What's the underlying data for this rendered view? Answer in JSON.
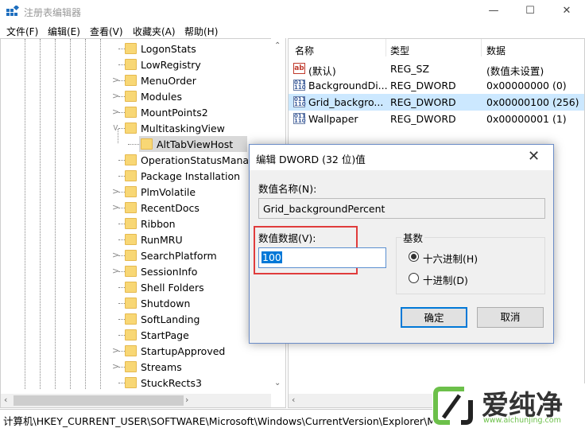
{
  "window": {
    "title": "注册表编辑器",
    "controls": {
      "minimize": "—",
      "maximize": "☐",
      "close": "✕"
    }
  },
  "menu": [
    "文件(F)",
    "编辑(E)",
    "查看(V)",
    "收藏夹(A)",
    "帮助(H)"
  ],
  "tree": {
    "items": [
      {
        "label": "LogonStats",
        "expander": "none"
      },
      {
        "label": "LowRegistry",
        "expander": "none"
      },
      {
        "label": "MenuOrder",
        "expander": "collapsed"
      },
      {
        "label": "Modules",
        "expander": "collapsed"
      },
      {
        "label": "MountPoints2",
        "expander": "collapsed"
      },
      {
        "label": "MultitaskingView",
        "expander": "expanded"
      },
      {
        "label": "AltTabViewHost",
        "expander": "none",
        "child": true,
        "selected": true
      },
      {
        "label": "OperationStatusManag",
        "expander": "none"
      },
      {
        "label": "Package Installation",
        "expander": "none"
      },
      {
        "label": "PlmVolatile",
        "expander": "collapsed"
      },
      {
        "label": "RecentDocs",
        "expander": "collapsed"
      },
      {
        "label": "Ribbon",
        "expander": "none"
      },
      {
        "label": "RunMRU",
        "expander": "none"
      },
      {
        "label": "SearchPlatform",
        "expander": "collapsed"
      },
      {
        "label": "SessionInfo",
        "expander": "collapsed"
      },
      {
        "label": "Shell Folders",
        "expander": "none"
      },
      {
        "label": "Shutdown",
        "expander": "none"
      },
      {
        "label": "SoftLanding",
        "expander": "none"
      },
      {
        "label": "StartPage",
        "expander": "none"
      },
      {
        "label": "StartupApproved",
        "expander": "collapsed"
      },
      {
        "label": "Streams",
        "expander": "collapsed"
      },
      {
        "label": "StuckRects3",
        "expander": "none"
      }
    ]
  },
  "values": {
    "columns": [
      "名称",
      "类型",
      "数据"
    ],
    "rows": [
      {
        "icon": "string-value-icon",
        "name": "(默认)",
        "type": "REG_SZ",
        "data": "(数值未设置)"
      },
      {
        "icon": "dword-value-icon",
        "name": "BackgroundDi...",
        "type": "REG_DWORD",
        "data": "0x00000000 (0)"
      },
      {
        "icon": "dword-value-icon",
        "name": "Grid_backgro...",
        "type": "REG_DWORD",
        "data": "0x00000100 (256)",
        "selected": true
      },
      {
        "icon": "dword-value-icon",
        "name": "Wallpaper",
        "type": "REG_DWORD",
        "data": "0x00000001 (1)"
      }
    ]
  },
  "status": "计算机\\HKEY_CURRENT_USER\\SOFTWARE\\Microsoft\\Windows\\CurrentVersion\\Explorer\\Mult",
  "dialog": {
    "title": "编辑 DWORD (32 位)值",
    "name_label": "数值名称(N):",
    "name_value": "Grid_backgroundPercent",
    "data_label": "数值数据(V):",
    "data_value": "100",
    "base_label": "基数",
    "hex_label": "十六进制(H)",
    "dec_label": "十进制(D)",
    "base_selected": "hex",
    "ok": "确定",
    "cancel": "取消",
    "highlight_color": "#e03c3c"
  },
  "watermark": {
    "brand": "爱纯净",
    "url": "www.aichunjing.com",
    "color": "#6cc04a"
  }
}
